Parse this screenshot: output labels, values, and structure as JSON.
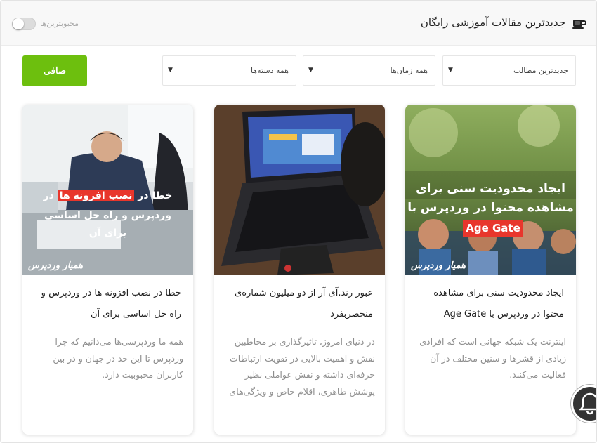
{
  "header": {
    "title": "جدیدترین مقالات آموزشی رایگان",
    "toggle_label": "محبوبترین‌ها",
    "toggle_on": false
  },
  "filters": {
    "sort": "جدیدترین مطالب",
    "time": "همه زمان‌ها",
    "category": "همه دسته‌ها",
    "clear_label": "صافی"
  },
  "colors": {
    "accent_green": "#6dbf0e",
    "highlight_red": "#e8362c"
  },
  "cards": [
    {
      "title": "ایجاد محدودیت سنی برای مشاهده محتوا در وردپرس با Age Gate",
      "excerpt": "اینترنت یک شبکه جهانی است که افرادی زیادی از قشرها و سنین مختلف در آن فعالیت می‌کنند.",
      "thumb_line1": "ایجاد محدودیت سنی برای",
      "thumb_line2": "مشاهده محتوا در وردپرس با",
      "thumb_badge": "Age Gate",
      "brand": "همیار وردپرس"
    },
    {
      "title": "عبور رند.آی آر از دو میلیون شماره‌ی منحصربفرد",
      "excerpt": "در دنیای امروز، تاثیرگذاری بر مخاطبین نقش و اهمیت بالایی در تقویت ارتباطات حرفه‌ای داشته و نقش عواملی نظیر پوشش ظاهری، اقلام خاص و ویژگی‌های"
    },
    {
      "title": "خطا در نصب افزونه ها در وردپرس و راه حل اساسی برای آن",
      "excerpt": "همه ما وردپرسی‌ها می‌دانیم که چرا وردپرس تا این حد در جهان و در بین کاربران محبوبیت دارد.",
      "thumb_pre": "خطا در ",
      "thumb_hl": "نصب افزونه ها",
      "thumb_post": " در",
      "thumb_line2": "وردپرس و راه حل اساسی",
      "thumb_line3": "برای آن",
      "brand": "همیار وردپرس"
    }
  ],
  "icons": {
    "header": "coffee-cup-icon",
    "floating": "bell-icon"
  }
}
